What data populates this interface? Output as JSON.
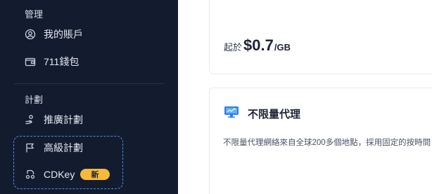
{
  "sidebar": {
    "section_manage": "管理",
    "items_manage": [
      {
        "label": "我的賬戶",
        "icon": "user-circle-icon"
      },
      {
        "label": "711錢包",
        "icon": "wallet-icon"
      }
    ],
    "section_plans": "計劃",
    "items_plans": [
      {
        "label": "推廣計劃",
        "icon": "promotion-icon"
      },
      {
        "label": "高級計劃",
        "icon": "flag-icon"
      },
      {
        "label": "CDKey",
        "icon": "key-icon"
      }
    ],
    "cdkey_badge": "新"
  },
  "main": {
    "price_card": {
      "prefix": "起於",
      "value": "$0.7",
      "unit": "/GB"
    },
    "unlimited_card": {
      "icon": "monitor-icon",
      "title": "不限量代理",
      "description": "不限量代理網絡來自全球200多個地點，採用固定的按時間"
    }
  },
  "colors": {
    "sidebar_bg": "#131c2e",
    "highlight_border": "#4d8df5",
    "badge_bg": "#f7b93a"
  }
}
